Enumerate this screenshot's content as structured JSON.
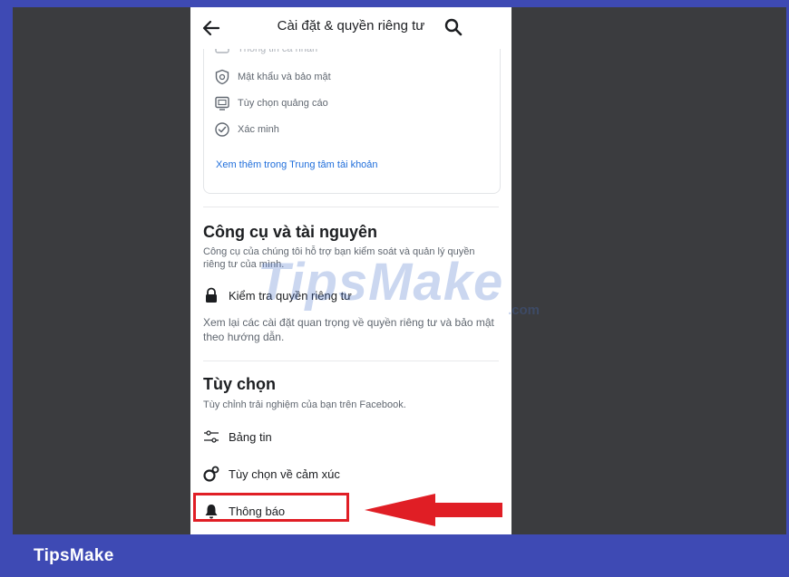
{
  "header": {
    "title": "Cài đặt & quyền riêng tư"
  },
  "account_card": {
    "faded_item": "Thông tin cá nhân",
    "items": [
      {
        "label": "Mật khẩu và bảo mật",
        "icon": "shield-icon"
      },
      {
        "label": "Tùy chọn quảng cáo",
        "icon": "ad-icon"
      },
      {
        "label": "Xác minh",
        "icon": "check-circle-icon"
      }
    ],
    "link": "Xem thêm trong Trung tâm tài khoản"
  },
  "tools": {
    "title": "Công cụ và tài nguyên",
    "desc": "Công cụ của chúng tôi hỗ trợ bạn kiểm soát và quản lý quyền riêng tư của mình.",
    "item_label": "Kiểm tra quyền riêng tư",
    "item_desc": "Xem lại các cài đặt quan trọng về quyền riêng tư và bảo mật theo hướng dẫn."
  },
  "preferences": {
    "title": "Tùy chọn",
    "desc": "Tùy chỉnh trải nghiệm của bạn trên Facebook.",
    "items": [
      {
        "label": "Bảng tin",
        "icon": "sliders-icon"
      },
      {
        "label": "Tùy chọn về cảm xúc",
        "icon": "reaction-icon"
      },
      {
        "label": "Thông báo",
        "icon": "bell-icon"
      }
    ]
  },
  "watermark": {
    "text": "TipsMake",
    "suffix": ".com"
  },
  "footer": {
    "brand": "TipsMake"
  },
  "colors": {
    "frame": "#3e4ab4",
    "background": "#3b3c3f",
    "link": "#216fdb",
    "highlight": "#e01e25"
  }
}
